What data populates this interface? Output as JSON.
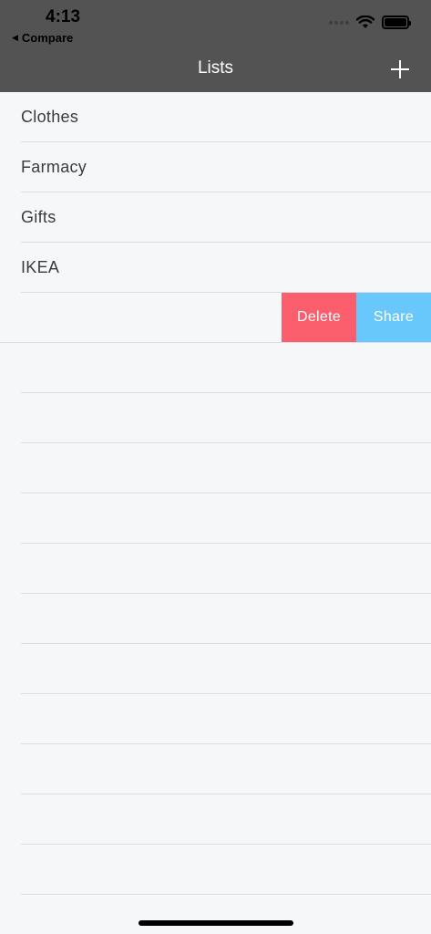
{
  "status_bar": {
    "time": "4:13",
    "back_label": "Compare"
  },
  "nav": {
    "title": "Lists"
  },
  "lists": [
    {
      "name": "Clothes"
    },
    {
      "name": "Farmacy"
    },
    {
      "name": "Gifts"
    },
    {
      "name": "IKEA"
    }
  ],
  "swipe_actions": {
    "delete_label": "Delete",
    "share_label": "Share"
  },
  "colors": {
    "header": "#535353",
    "delete": "#fb5f6d",
    "share": "#68c8fc",
    "background": "#f6f7f9"
  }
}
